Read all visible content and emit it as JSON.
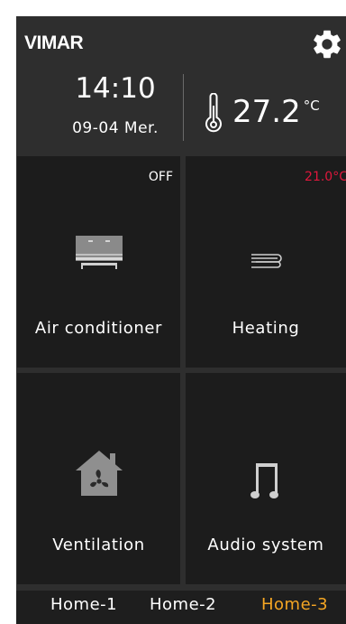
{
  "header": {
    "logo": "VIMAR",
    "time": "14:10",
    "date": "09-04 Mer.",
    "temperature": "27.2",
    "temperature_unit": "°C"
  },
  "tiles": [
    {
      "label": "Air conditioner",
      "status": "OFF",
      "status_color": "#ffffff",
      "icon": "air-conditioner-icon"
    },
    {
      "label": "Heating",
      "status": "21.0°C",
      "status_color": "#e0173c",
      "icon": "heating-icon"
    },
    {
      "label": "Ventilation",
      "icon": "ventilation-icon"
    },
    {
      "label": "Audio system",
      "icon": "music-note-icon"
    }
  ],
  "nav": {
    "items": [
      "Home-1",
      "Home-2",
      "Home-3"
    ],
    "active_index": 2,
    "active_color": "#f5a623"
  },
  "colors": {
    "background": "#2e2e2e",
    "tile": "#1c1c1c",
    "text": "#ffffff"
  }
}
